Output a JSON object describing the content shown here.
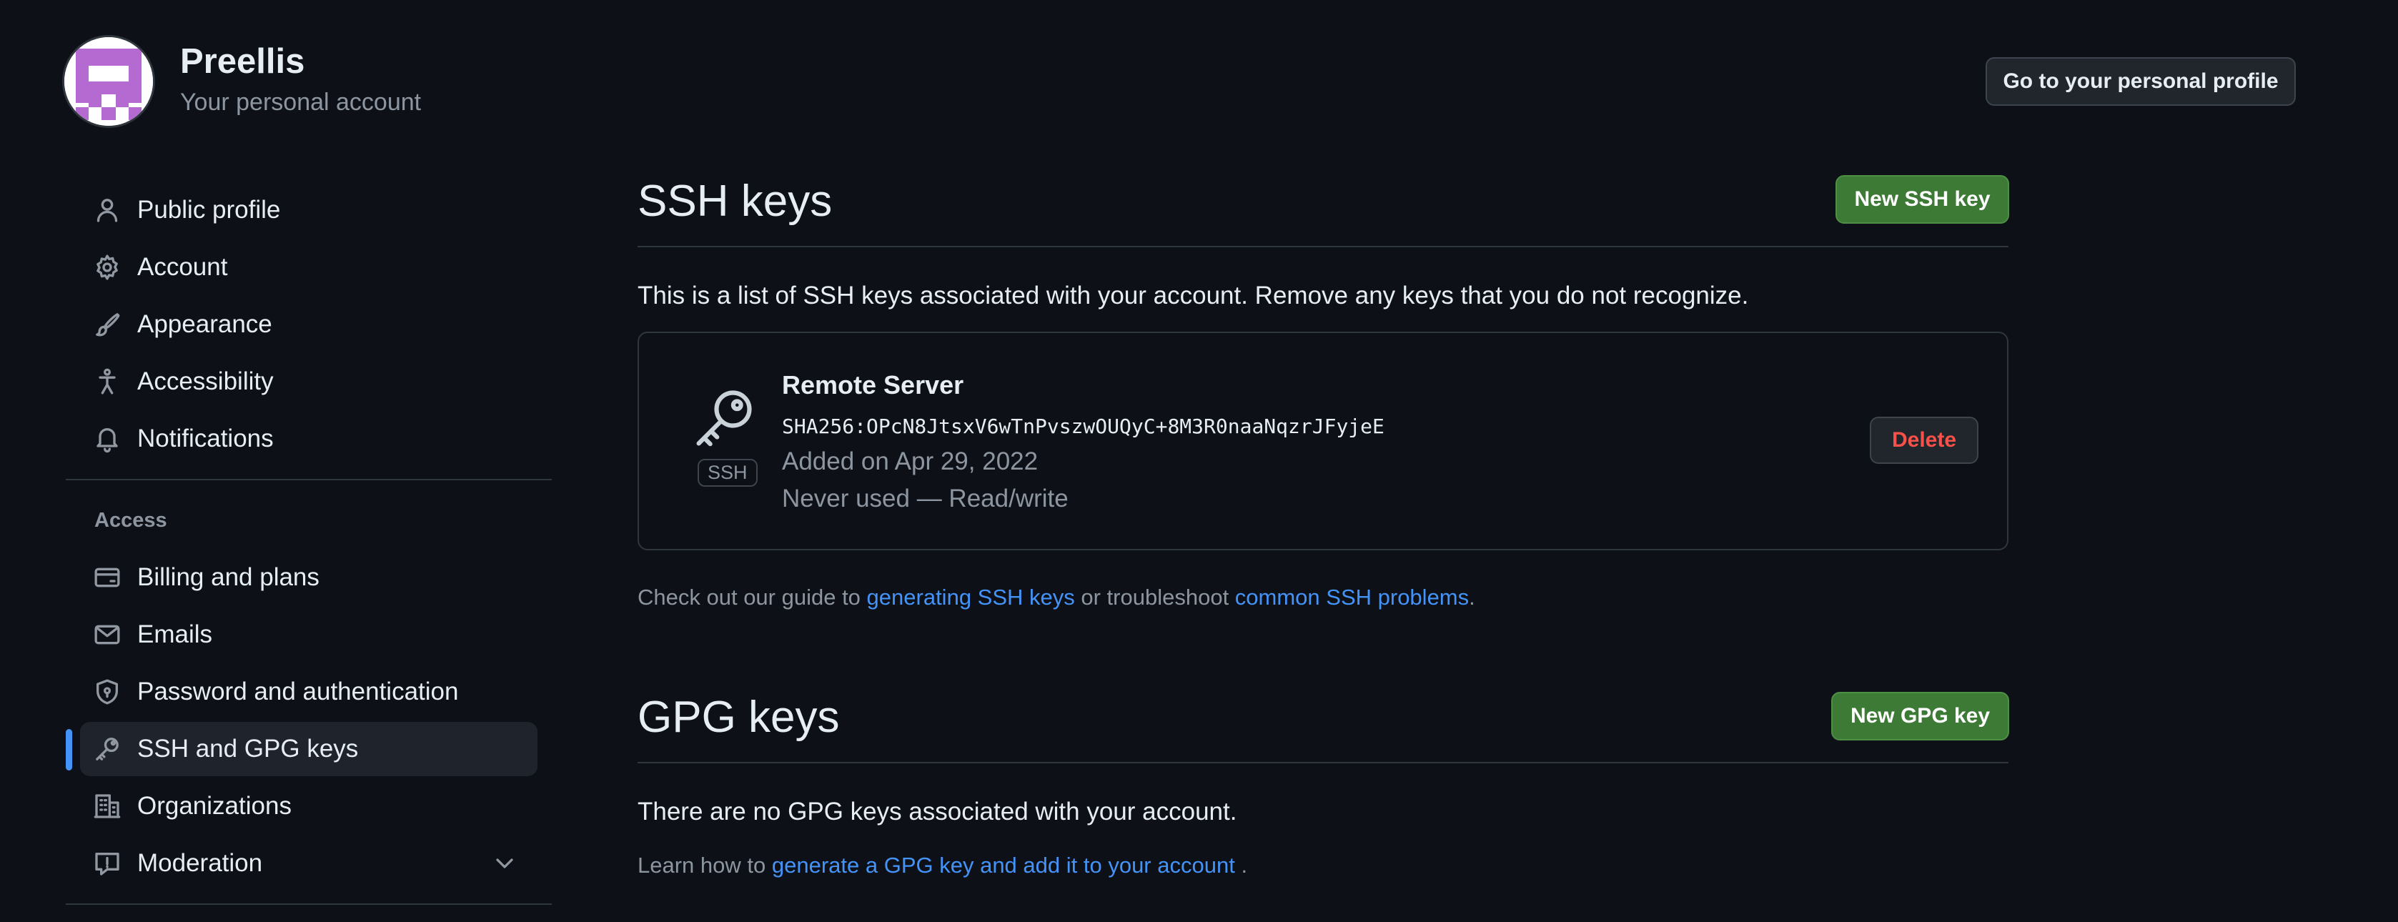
{
  "header": {
    "user_name": "Preellis",
    "user_subtitle": "Your personal account",
    "profile_button": "Go to your personal profile",
    "avatar_icon": "identicon-avatar",
    "avatar_color": "#b46ad1"
  },
  "sidebar": {
    "items": [
      {
        "label": "Public profile",
        "icon": "person-icon"
      },
      {
        "label": "Account",
        "icon": "gear-icon"
      },
      {
        "label": "Appearance",
        "icon": "paintbrush-icon"
      },
      {
        "label": "Accessibility",
        "icon": "accessibility-icon"
      },
      {
        "label": "Notifications",
        "icon": "bell-icon"
      }
    ],
    "access_heading": "Access",
    "access_items": [
      {
        "label": "Billing and plans",
        "icon": "credit-card-icon"
      },
      {
        "label": "Emails",
        "icon": "mail-icon"
      },
      {
        "label": "Password and authentication",
        "icon": "shield-lock-icon"
      },
      {
        "label": "SSH and GPG keys",
        "icon": "key-icon",
        "active": true
      },
      {
        "label": "Organizations",
        "icon": "organization-icon"
      },
      {
        "label": "Moderation",
        "icon": "report-icon"
      }
    ]
  },
  "ssh": {
    "title": "SSH keys",
    "new_button": "New SSH key",
    "description": "This is a list of SSH keys associated with your account. Remove any keys that you do not recognize.",
    "key": {
      "name": "Remote Server",
      "fingerprint": "SHA256:OPcN8JtsxV6wTnPvszwOUQyC+8M3R0naaNqzrJFyjeE",
      "added": "Added on Apr 29, 2022",
      "usage": "Never used — Read/write",
      "type_label": "SSH",
      "delete_label": "Delete"
    },
    "guide_prefix": "Check out our guide to ",
    "guide_link1": "generating SSH keys",
    "guide_middle": " or troubleshoot ",
    "guide_link2": "common SSH problems",
    "guide_suffix": "."
  },
  "gpg": {
    "title": "GPG keys",
    "new_button": "New GPG key",
    "empty_text": "There are no GPG keys associated with your account.",
    "learn_prefix": "Learn how to ",
    "learn_link": "generate a GPG key and add it to your account",
    "learn_suffix": " ."
  },
  "colors": {
    "background": "#0d1117",
    "accent": "#4493f8",
    "primary_button": "#3d7a35",
    "danger": "#f85149"
  }
}
